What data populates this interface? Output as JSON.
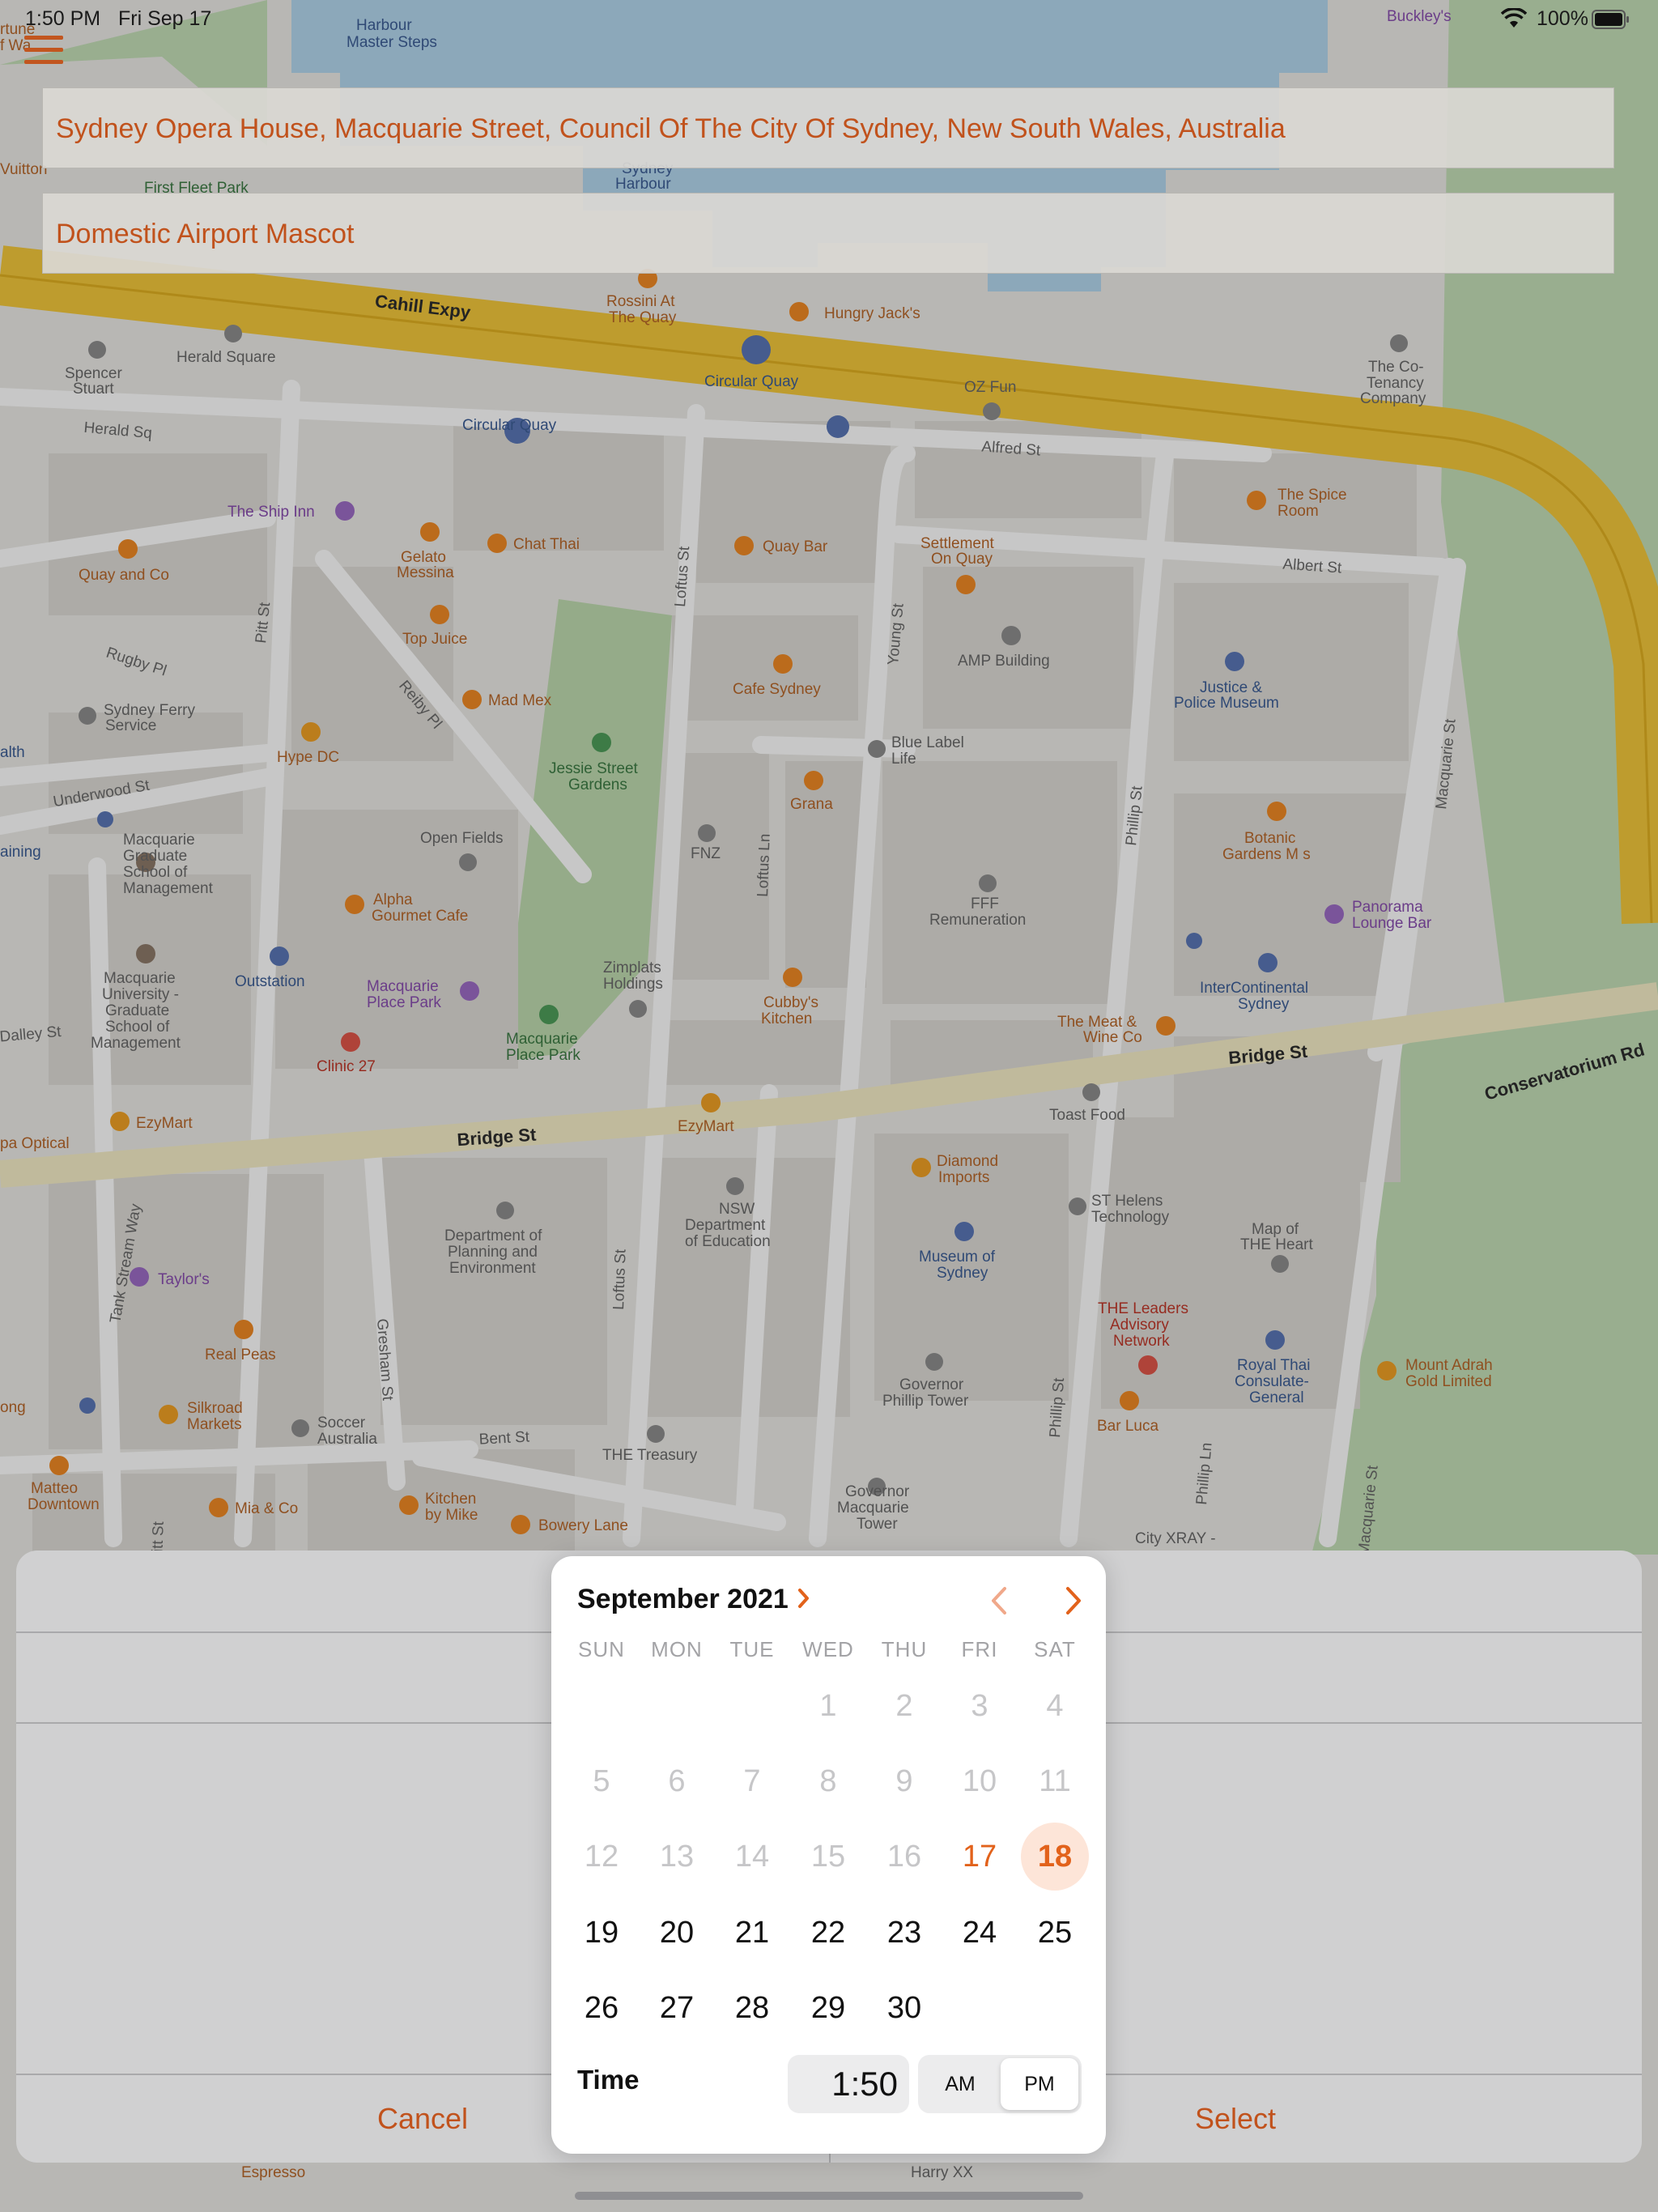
{
  "status_bar": {
    "time": "1:50 PM",
    "date": "Fri Sep 17",
    "battery": "100%"
  },
  "route": {
    "from": "Sydney Opera House, Macquarie Street, Council Of The City Of Sydney, New South Wales, Australia",
    "to": "Domestic Airport Mascot"
  },
  "map_labels": [
    {
      "text": "Harbour",
      "cls": "poi-b"
    },
    {
      "text": "Master Steps",
      "cls": "poi-b"
    },
    {
      "text": "Buckley's",
      "cls": "poi-p"
    },
    {
      "text": "Sydney",
      "cls": "poi-b"
    },
    {
      "text": "Harbour",
      "cls": "poi-b"
    },
    {
      "text": "First Fleet Park",
      "cls": "poi-g"
    },
    {
      "text": "Vuitton",
      "cls": "poi-o"
    },
    {
      "text": "Cahill Expy",
      "cls": "road"
    },
    {
      "text": "Rossini At",
      "cls": "poi-o"
    },
    {
      "text": "The Quay",
      "cls": "poi-o"
    },
    {
      "text": "Hungry Jack's",
      "cls": "poi-o"
    },
    {
      "text": "Herald Square",
      "cls": "poi-n"
    },
    {
      "text": "Spencer",
      "cls": "poi-n"
    },
    {
      "text": "Stuart",
      "cls": "poi-n"
    },
    {
      "text": "Circular Quay",
      "cls": "poi-b"
    },
    {
      "text": "Circular Quay",
      "cls": "poi-b"
    },
    {
      "text": "OZ Fun",
      "cls": "poi-n"
    },
    {
      "text": "The Co-",
      "cls": "poi-n"
    },
    {
      "text": "Tenancy",
      "cls": "poi-n"
    },
    {
      "text": "Company",
      "cls": "poi-n"
    },
    {
      "text": "Herald Sq",
      "cls": "street"
    },
    {
      "text": "Alfred St",
      "cls": "street"
    },
    {
      "text": "The Ship Inn",
      "cls": "poi-p"
    },
    {
      "text": "Gelato",
      "cls": "poi-o"
    },
    {
      "text": "Messina",
      "cls": "poi-o"
    },
    {
      "text": "Chat Thai",
      "cls": "poi-o"
    },
    {
      "text": "Quay Bar",
      "cls": "poi-o"
    },
    {
      "text": "Settlement",
      "cls": "poi-o"
    },
    {
      "text": "On Quay",
      "cls": "poi-o"
    },
    {
      "text": "The Spice",
      "cls": "poi-o"
    },
    {
      "text": "Room",
      "cls": "poi-o"
    },
    {
      "text": "Quay and Co",
      "cls": "poi-o"
    },
    {
      "text": "Albert St",
      "cls": "street"
    },
    {
      "text": "Top Juice",
      "cls": "poi-o"
    },
    {
      "text": "AMP Building",
      "cls": "poi-n"
    },
    {
      "text": "Justice &",
      "cls": "poi-b"
    },
    {
      "text": "Police Museum",
      "cls": "poi-b"
    },
    {
      "text": "Cafe Sydney",
      "cls": "poi-o"
    },
    {
      "text": "Sydney Ferry",
      "cls": "poi-n"
    },
    {
      "text": "Service",
      "cls": "poi-n"
    },
    {
      "text": "Mad Mex",
      "cls": "poi-o"
    },
    {
      "text": "Hype DC",
      "cls": "poi-o"
    },
    {
      "text": "Blue Label",
      "cls": "poi-n"
    },
    {
      "text": "Life",
      "cls": "poi-n"
    },
    {
      "text": "Jessie Street",
      "cls": "poi-g"
    },
    {
      "text": "Gardens",
      "cls": "poi-g"
    },
    {
      "text": "Grana",
      "cls": "poi-o"
    },
    {
      "text": "Underwood St",
      "cls": "street"
    },
    {
      "text": "Macquarie",
      "cls": "poi-n"
    },
    {
      "text": "Graduate",
      "cls": "poi-n"
    },
    {
      "text": "School of",
      "cls": "poi-n"
    },
    {
      "text": "Management",
      "cls": "poi-n"
    },
    {
      "text": "Open Fields",
      "cls": "poi-n"
    },
    {
      "text": "FNZ",
      "cls": "poi-n"
    },
    {
      "text": "Botanic",
      "cls": "poi-o"
    },
    {
      "text": "Gardens M s",
      "cls": "poi-o"
    },
    {
      "text": "Alpha",
      "cls": "poi-o"
    },
    {
      "text": "Gourmet Cafe",
      "cls": "poi-o"
    },
    {
      "text": "FFF",
      "cls": "poi-n"
    },
    {
      "text": "Remuneration",
      "cls": "poi-n"
    },
    {
      "text": "Panorama",
      "cls": "poi-p"
    },
    {
      "text": "Lounge Bar",
      "cls": "poi-p"
    },
    {
      "text": "Outstation",
      "cls": "poi-b"
    },
    {
      "text": "Macquarie",
      "cls": "poi-n"
    },
    {
      "text": "University -",
      "cls": "poi-n"
    },
    {
      "text": "Graduate",
      "cls": "poi-n"
    },
    {
      "text": "School of",
      "cls": "poi-n"
    },
    {
      "text": "Management",
      "cls": "poi-n"
    },
    {
      "text": "Macquarie",
      "cls": "poi-p"
    },
    {
      "text": "Place Park",
      "cls": "poi-p"
    },
    {
      "text": "Zimplats",
      "cls": "poi-n"
    },
    {
      "text": "Holdings",
      "cls": "poi-n"
    },
    {
      "text": "Cubby's",
      "cls": "poi-o"
    },
    {
      "text": "Kitchen",
      "cls": "poi-o"
    },
    {
      "text": "InterContinental",
      "cls": "poi-b"
    },
    {
      "text": "Sydney",
      "cls": "poi-b"
    },
    {
      "text": "Macquarie",
      "cls": "poi-g"
    },
    {
      "text": "Place Park",
      "cls": "poi-g"
    },
    {
      "text": "The Meat &",
      "cls": "poi-o"
    },
    {
      "text": "Wine Co",
      "cls": "poi-o"
    },
    {
      "text": "Clinic 27",
      "cls": "poi-r"
    },
    {
      "text": "Bridge St",
      "cls": "road"
    },
    {
      "text": "Conservatorium Rd",
      "cls": "road"
    },
    {
      "text": "Toast Food",
      "cls": "poi-n"
    },
    {
      "text": "EzyMart",
      "cls": "poi-o"
    },
    {
      "text": "EzyMart",
      "cls": "poi-o"
    },
    {
      "text": "pa Optical",
      "cls": "poi-o"
    },
    {
      "text": "Bridge St",
      "cls": "road"
    },
    {
      "text": "Diamond",
      "cls": "poi-o"
    },
    {
      "text": "Imports",
      "cls": "poi-o"
    },
    {
      "text": "NSW",
      "cls": "poi-n"
    },
    {
      "text": "Department",
      "cls": "poi-n"
    },
    {
      "text": "of Education",
      "cls": "poi-n"
    },
    {
      "text": "ST Helens",
      "cls": "poi-n"
    },
    {
      "text": "Technology",
      "cls": "poi-n"
    },
    {
      "text": "Department of",
      "cls": "poi-n"
    },
    {
      "text": "Planning and",
      "cls": "poi-n"
    },
    {
      "text": "Environment",
      "cls": "poi-n"
    },
    {
      "text": "Museum of",
      "cls": "poi-b"
    },
    {
      "text": "Sydney",
      "cls": "poi-b"
    },
    {
      "text": "Map of",
      "cls": "poi-n"
    },
    {
      "text": "THE Heart",
      "cls": "poi-n"
    },
    {
      "text": "Taylor's",
      "cls": "poi-p"
    },
    {
      "text": "THE Leaders",
      "cls": "poi-r"
    },
    {
      "text": "Advisory",
      "cls": "poi-r"
    },
    {
      "text": "Network",
      "cls": "poi-r"
    },
    {
      "text": "Real Peas",
      "cls": "poi-o"
    },
    {
      "text": "Governor",
      "cls": "poi-n"
    },
    {
      "text": "Phillip Tower",
      "cls": "poi-n"
    },
    {
      "text": "Royal Thai",
      "cls": "poi-b"
    },
    {
      "text": "Consulate-",
      "cls": "poi-b"
    },
    {
      "text": "General",
      "cls": "poi-b"
    },
    {
      "text": "Mount Adrah",
      "cls": "poi-o"
    },
    {
      "text": "Gold Limited",
      "cls": "poi-o"
    },
    {
      "text": "Silkroad",
      "cls": "poi-o"
    },
    {
      "text": "Markets",
      "cls": "poi-o"
    },
    {
      "text": "Soccer",
      "cls": "poi-n"
    },
    {
      "text": "Australia",
      "cls": "poi-n"
    },
    {
      "text": "Bar Luca",
      "cls": "poi-o"
    },
    {
      "text": "Bent St",
      "cls": "street"
    },
    {
      "text": "THE Treasury",
      "cls": "poi-n"
    },
    {
      "text": "Matteo",
      "cls": "poi-o"
    },
    {
      "text": "Downtown",
      "cls": "poi-o"
    },
    {
      "text": "Kitchen",
      "cls": "poi-o"
    },
    {
      "text": "by Mike",
      "cls": "poi-o"
    },
    {
      "text": "Mia & Co",
      "cls": "poi-o"
    },
    {
      "text": "Bowery Lane",
      "cls": "poi-o"
    },
    {
      "text": "Governor",
      "cls": "poi-n"
    },
    {
      "text": "Macquarie",
      "cls": "poi-n"
    },
    {
      "text": "Tower",
      "cls": "poi-n"
    },
    {
      "text": "City XRAY -",
      "cls": "poi-n"
    },
    {
      "text": "Pitt St",
      "cls": "street"
    },
    {
      "text": "Loftus St",
      "cls": "street"
    },
    {
      "text": "Young St",
      "cls": "street"
    },
    {
      "text": "Phillip St",
      "cls": "street"
    },
    {
      "text": "Macquarie St",
      "cls": "street"
    },
    {
      "text": "Loftus Ln",
      "cls": "street"
    },
    {
      "text": "Reiby Pl",
      "cls": "street"
    },
    {
      "text": "Rugby Pl",
      "cls": "street"
    },
    {
      "text": "Dalley St",
      "cls": "street"
    },
    {
      "text": "Tank Stream Way",
      "cls": "street"
    },
    {
      "text": "Gresham St",
      "cls": "street"
    },
    {
      "text": "Loftus St",
      "cls": "street"
    },
    {
      "text": "Phillip St",
      "cls": "street"
    },
    {
      "text": "Phillip Ln",
      "cls": "street"
    },
    {
      "text": "Macquarie St",
      "cls": "street"
    },
    {
      "text": "Pitt St",
      "cls": "street"
    },
    {
      "text": "Espresso",
      "cls": "poi-o"
    },
    {
      "text": "Harry XX",
      "cls": "poi-n"
    },
    {
      "text": "alth",
      "cls": "poi-b"
    },
    {
      "text": "aining",
      "cls": "poi-b"
    },
    {
      "text": "rtune",
      "cls": "poi-o"
    },
    {
      "text": "f Wa",
      "cls": "poi-o"
    },
    {
      "text": "ong",
      "cls": "poi-o"
    }
  ],
  "sheet": {
    "cancel_label": "Cancel",
    "select_label": "Select"
  },
  "calendar": {
    "month_label": "September 2021",
    "weekdays": [
      "SUN",
      "MON",
      "TUE",
      "WED",
      "THU",
      "FRI",
      "SAT"
    ],
    "weeks": [
      [
        null,
        null,
        null,
        "1",
        "2",
        "3",
        "4"
      ],
      [
        "5",
        "6",
        "7",
        "8",
        "9",
        "10",
        "11"
      ],
      [
        "12",
        "13",
        "14",
        "15",
        "16",
        "17",
        "18"
      ],
      [
        "19",
        "20",
        "21",
        "22",
        "23",
        "24",
        "25"
      ],
      [
        "26",
        "27",
        "28",
        "29",
        "30",
        null,
        null
      ]
    ],
    "today": "17",
    "selected": "18",
    "disabled_before": 17
  },
  "time": {
    "label": "Time",
    "value": "1:50",
    "am_label": "AM",
    "pm_label": "PM",
    "period": "PM"
  },
  "colors": {
    "accent": "#e2621b",
    "selected_bg": "#fde5d8",
    "disabled_day": "#c6c6c8"
  }
}
